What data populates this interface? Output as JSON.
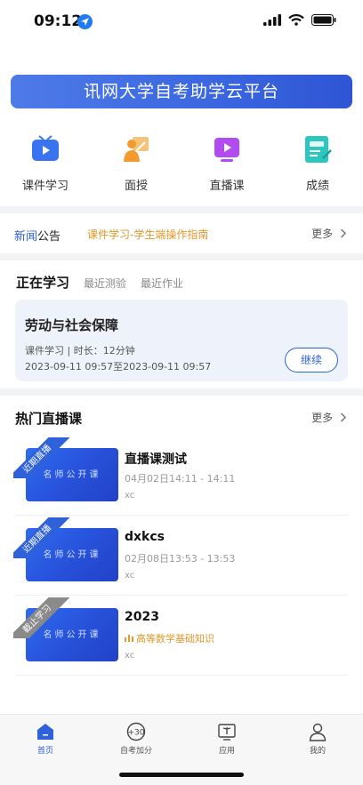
{
  "status_bar": {
    "time": "09:12"
  },
  "banner": {
    "title": "讯网大学自考助学云平台"
  },
  "quick_links": [
    {
      "label": "课件学习",
      "icon": "tv-icon",
      "color": "#3a73f0"
    },
    {
      "label": "面授",
      "icon": "teacher-icon",
      "color": "#f29a2e"
    },
    {
      "label": "直播课",
      "icon": "live-icon",
      "color": "#b24bf0"
    },
    {
      "label": "成绩",
      "icon": "score-icon",
      "color": "#2ec7c0"
    }
  ],
  "news": {
    "label_a": "新闻",
    "label_b": "公告",
    "headline": "课件学习-学生端操作指南",
    "more": "更多"
  },
  "study": {
    "tabs": [
      "正在学习",
      "最近测验",
      "最近作业"
    ],
    "card": {
      "title": "劳动与社会保障",
      "meta": "课件学习 | 时长：12分钟",
      "time": "2023-09-11 09:57至2023-09-11 09:57",
      "button": "继续"
    }
  },
  "live": {
    "heading": "热门直播课",
    "more": "更多",
    "thumb_text": "名师公开课",
    "items": [
      {
        "ribbon": "近期直播",
        "ribbon_color": "#2f61d9",
        "name": "直播课测试",
        "sub": "04月02日14:11 - 14:11",
        "teacher": "xc"
      },
      {
        "ribbon": "近期直播",
        "ribbon_color": "#2f61d9",
        "name": "dxkcs",
        "sub": "02月08日13:53 - 13:53",
        "teacher": "xc"
      },
      {
        "ribbon": "截止学习",
        "ribbon_color": "#8a8a8a",
        "name": "2023",
        "sub": "高等数学基础知识",
        "teacher": "xc"
      }
    ]
  },
  "tabbar": [
    {
      "label": "首页",
      "icon": "home-icon",
      "active": true
    },
    {
      "label": "自考加分",
      "icon": "plus30-icon"
    },
    {
      "label": "应用",
      "icon": "book-icon"
    },
    {
      "label": "我的",
      "icon": "user-icon"
    }
  ]
}
